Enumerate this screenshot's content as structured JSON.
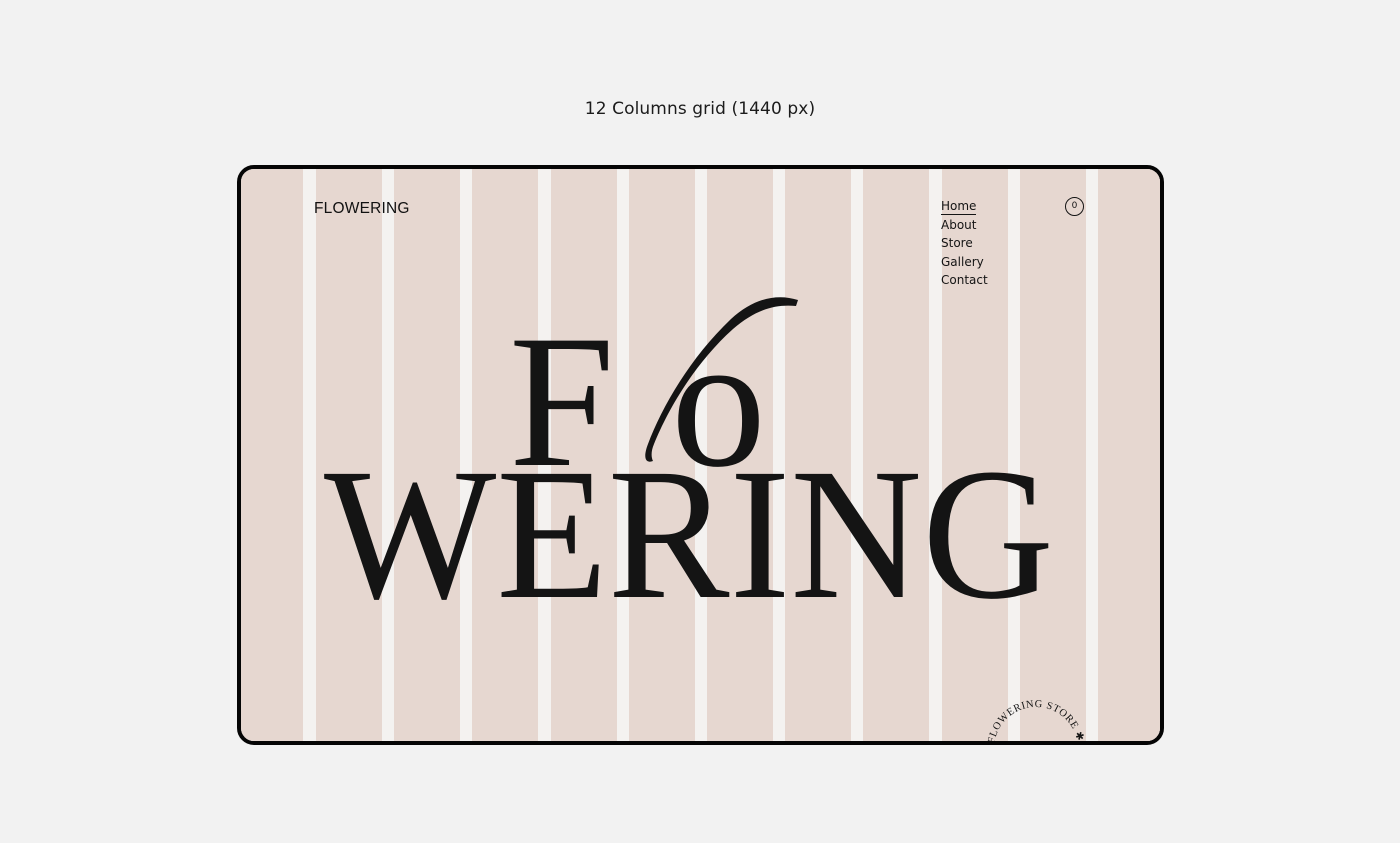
{
  "caption": "12 Columns grid (1440 px)",
  "header": {
    "brand": "FLOWERING",
    "nav": [
      "Home",
      "About",
      "Store",
      "Gallery",
      "Contact"
    ],
    "active_nav": "Home",
    "cart_count": "0"
  },
  "hero": {
    "line1_a": "F",
    "line1_b": "o",
    "line2": "WERING"
  },
  "stamp": {
    "text": "FLOWERING STORE ✱"
  },
  "colors": {
    "page_bg": "#f2f2f2",
    "column_fill": "#e6d7d0",
    "gutter": "#f4f2f0",
    "ink": "#141414",
    "frame_border": "#050505"
  },
  "grid": {
    "columns": 12
  }
}
